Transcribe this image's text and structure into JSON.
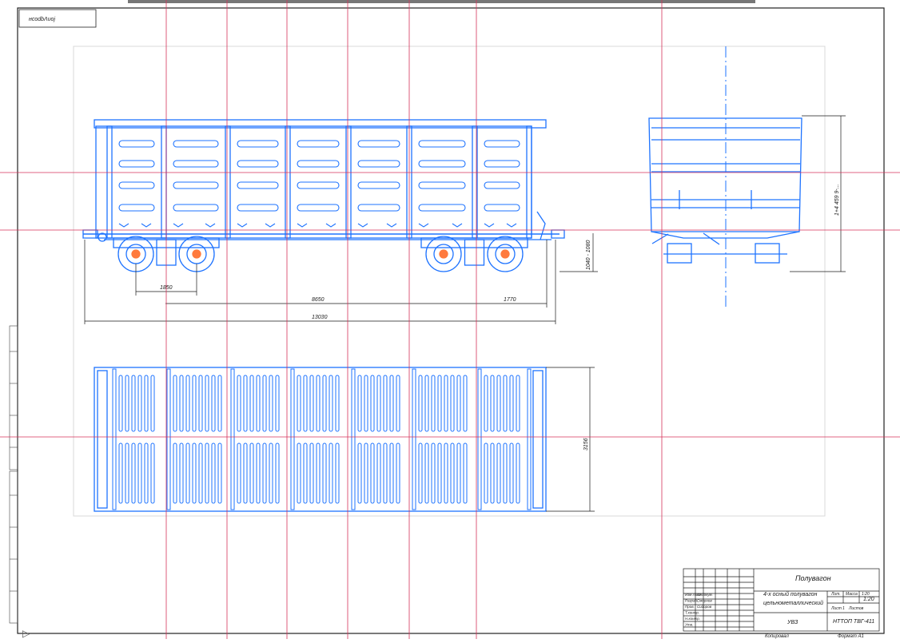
{
  "stamp": {
    "top_left": "нсоdbΛυοϳ"
  },
  "dimensions": {
    "bogie_base": "1850",
    "truck_centers": "8650",
    "overhang": "1770",
    "overall_length": "13030",
    "height_range": "1040 - 1080",
    "side_height": "1+4 459 9-...",
    "inner_width": "3156"
  },
  "title_block": {
    "product_title": "Полувагон",
    "description_line1": "4-х осный полувагон",
    "description_line2": "цельнометаллический",
    "doc_code": "УВЗ",
    "org_code": "НТТОП ТВГ-411",
    "scale": "1:20",
    "sheet_label": "Лист",
    "sheets_label": "Листов",
    "mass_label": "Масса",
    "litera_label": "Лит.",
    "copy_label": "Копировал",
    "format_label": "Формат А1",
    "sheet_num": "1",
    "rows": [
      "Изм Лист",
      "Разраб.",
      "Пров.",
      "Т.контр.",
      "Н.контр.",
      "Утв."
    ],
    "names": [
      "№ докум.",
      "Смирнов",
      "Сидоров"
    ]
  },
  "guide_markers": {
    "arrow": "▷"
  }
}
